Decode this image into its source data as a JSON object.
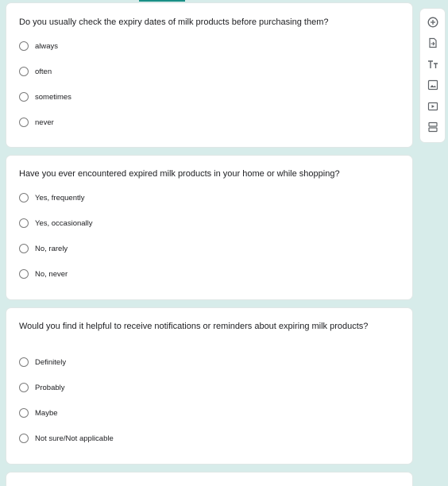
{
  "questions": [
    {
      "title": "Do you usually check the expiry dates of milk products before purchasing them?",
      "options": [
        "always",
        "often",
        "sometimes",
        "never"
      ]
    },
    {
      "title": "Have you ever encountered expired milk products in your home or while shopping?",
      "options": [
        "Yes, frequently",
        "Yes, occasionally",
        "No, rarely",
        "No, never"
      ]
    },
    {
      "title": "Would you find it helpful to receive notifications or reminders about expiring milk products?",
      "options": [
        "Definitely",
        "Probably",
        "Maybe",
        "Not sure/Not applicable"
      ]
    }
  ],
  "toolbar": {
    "icons": [
      "add-question-icon",
      "import-questions-icon",
      "add-title-icon",
      "add-image-icon",
      "add-video-icon",
      "add-section-icon"
    ]
  },
  "colors": {
    "background": "#d7ecea",
    "accent": "#1a8f86",
    "card": "#ffffff"
  }
}
